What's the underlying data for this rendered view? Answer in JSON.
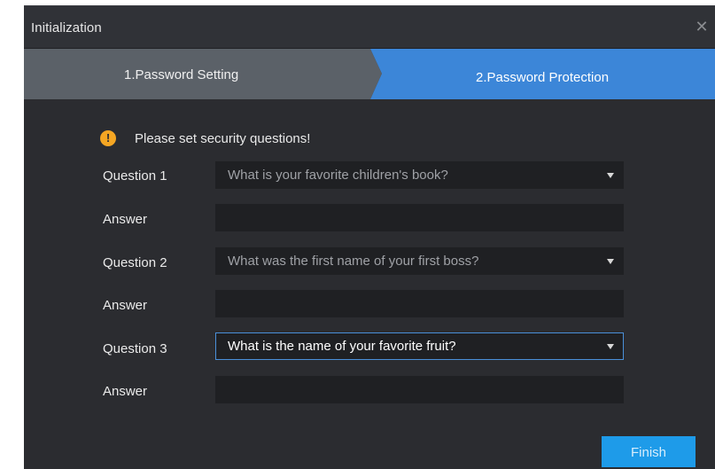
{
  "dialog": {
    "title": "Initialization",
    "close_icon": "close-icon"
  },
  "steps": [
    {
      "label": "1.Password Setting",
      "active": false
    },
    {
      "label": "2.Password Protection",
      "active": true
    }
  ],
  "notice": {
    "icon": "warning-icon",
    "text": "Please set security questions!"
  },
  "questions": [
    {
      "label": "Question 1",
      "selected": "What is your favorite children's book?",
      "answer_label": "Answer",
      "answer_value": ""
    },
    {
      "label": "Question 2",
      "selected": "What was the first name of your first boss?",
      "answer_label": "Answer",
      "answer_value": ""
    },
    {
      "label": "Question 3",
      "selected": "What is the name of your favorite fruit?",
      "answer_label": "Answer",
      "answer_value": "",
      "focused": true
    }
  ],
  "footer": {
    "finish_label": "Finish"
  },
  "colors": {
    "background": "#2b2c30",
    "step_inactive": "#5a6068",
    "step_active": "#3b84d6",
    "accent": "#1e9be9",
    "warning": "#f5a623"
  }
}
